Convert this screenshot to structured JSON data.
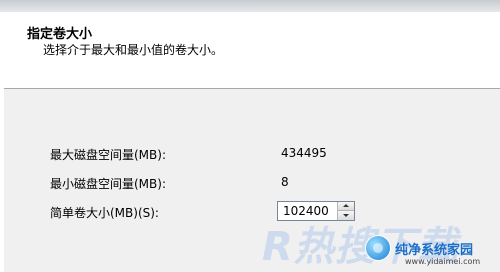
{
  "header": {
    "title": "指定卷大小",
    "subtitle": "选择介于最大和最小值的卷大小。"
  },
  "fields": {
    "max_label": "最大磁盘空间量(MB):",
    "max_value": "434495",
    "min_label": "最小磁盘空间量(MB):",
    "min_value": "8",
    "size_label": "简单卷大小(MB)(S):",
    "size_value": "102400"
  },
  "watermark": {
    "big_text": "R热搜下载",
    "brand": "纯净系统家园",
    "url": "www.yidaimei.com"
  },
  "icons": {
    "spin_up": "chevron-up-icon",
    "spin_down": "chevron-down-icon",
    "logo": "brand-logo-icon"
  }
}
